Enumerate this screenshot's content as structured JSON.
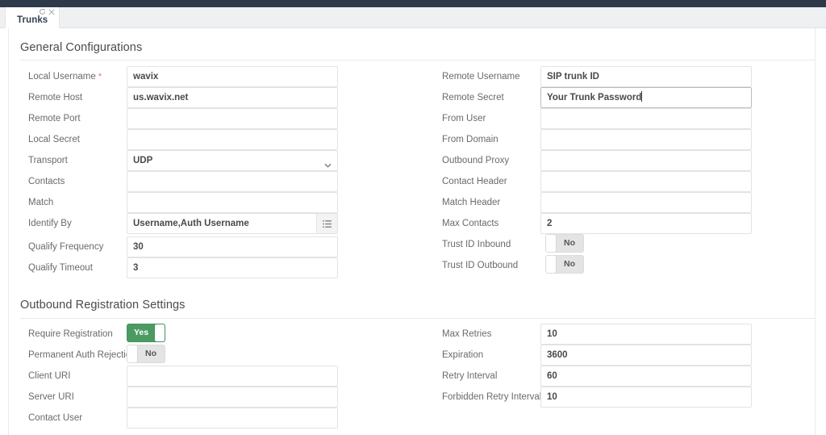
{
  "window": {
    "tab": {
      "label": "Trunks",
      "refresh_icon": "refresh-icon",
      "close_icon": "close-icon"
    }
  },
  "sections": [
    {
      "id": "general",
      "title": "General Configurations",
      "left_fields": [
        {
          "label": "Local Username",
          "required": true,
          "type": "text",
          "value": "wavix"
        },
        {
          "label": "Remote Host",
          "required": false,
          "type": "text",
          "value": "us.wavix.net"
        },
        {
          "label": "Remote Port",
          "required": false,
          "type": "text",
          "value": ""
        },
        {
          "label": "Local Secret",
          "required": false,
          "type": "text",
          "value": ""
        },
        {
          "label": "Transport",
          "required": false,
          "type": "select",
          "value": "UDP"
        },
        {
          "label": "Contacts",
          "required": false,
          "type": "text",
          "value": ""
        },
        {
          "label": "Match",
          "required": false,
          "type": "text",
          "value": ""
        },
        {
          "label": "Identify By",
          "required": false,
          "type": "group",
          "value": "Username,Auth Username",
          "addon_icon": "list-icon"
        },
        {
          "label": "Qualify Frequency",
          "required": false,
          "type": "text",
          "value": "30"
        },
        {
          "label": "Qualify Timeout",
          "required": false,
          "type": "text",
          "value": "3"
        }
      ],
      "right_fields": [
        {
          "label": "Remote Username",
          "required": false,
          "type": "text",
          "value": "SIP trunk ID"
        },
        {
          "label": "Remote Secret",
          "required": false,
          "type": "text",
          "value": "Your Trunk Password",
          "focused": true
        },
        {
          "label": "From User",
          "required": false,
          "type": "text",
          "value": ""
        },
        {
          "label": "From Domain",
          "required": false,
          "type": "text",
          "value": ""
        },
        {
          "label": "Outbound Proxy",
          "required": false,
          "type": "text",
          "value": ""
        },
        {
          "label": "Contact Header",
          "required": false,
          "type": "text",
          "value": ""
        },
        {
          "label": "Match Header",
          "required": false,
          "type": "text",
          "value": ""
        },
        {
          "label": "Max Contacts",
          "required": false,
          "type": "text",
          "value": "2"
        },
        {
          "label": "Trust ID Inbound",
          "required": false,
          "type": "toggle",
          "value": "No"
        },
        {
          "label": "Trust ID Outbound",
          "required": false,
          "type": "toggle",
          "value": "No"
        }
      ]
    },
    {
      "id": "outbound",
      "title": "Outbound Registration Settings",
      "left_fields": [
        {
          "label": "Require Registration",
          "required": false,
          "type": "toggle",
          "value": "Yes"
        },
        {
          "label": "Permanent Auth Rejection",
          "required": false,
          "type": "toggle",
          "value": "No"
        },
        {
          "label": "Client URI",
          "required": false,
          "type": "text",
          "value": ""
        },
        {
          "label": "Server URI",
          "required": false,
          "type": "text",
          "value": ""
        },
        {
          "label": "Contact User",
          "required": false,
          "type": "text",
          "value": ""
        }
      ],
      "right_fields": [
        {
          "label": "Max Retries",
          "required": false,
          "type": "text",
          "value": "10"
        },
        {
          "label": "Expiration",
          "required": false,
          "type": "text",
          "value": "3600"
        },
        {
          "label": "Retry Interval",
          "required": false,
          "type": "text",
          "value": "60"
        },
        {
          "label": "Forbidden Retry Interval",
          "required": false,
          "type": "text",
          "value": "10"
        }
      ]
    }
  ],
  "colors": {
    "topbar": "#2e3a4b",
    "toggle_on": "#4b9a62",
    "toggle_off": "#e4e4e4",
    "required_asterisk": "#e8776d",
    "label_text": "#6a6a6a",
    "value_text": "#4a4a4a"
  }
}
